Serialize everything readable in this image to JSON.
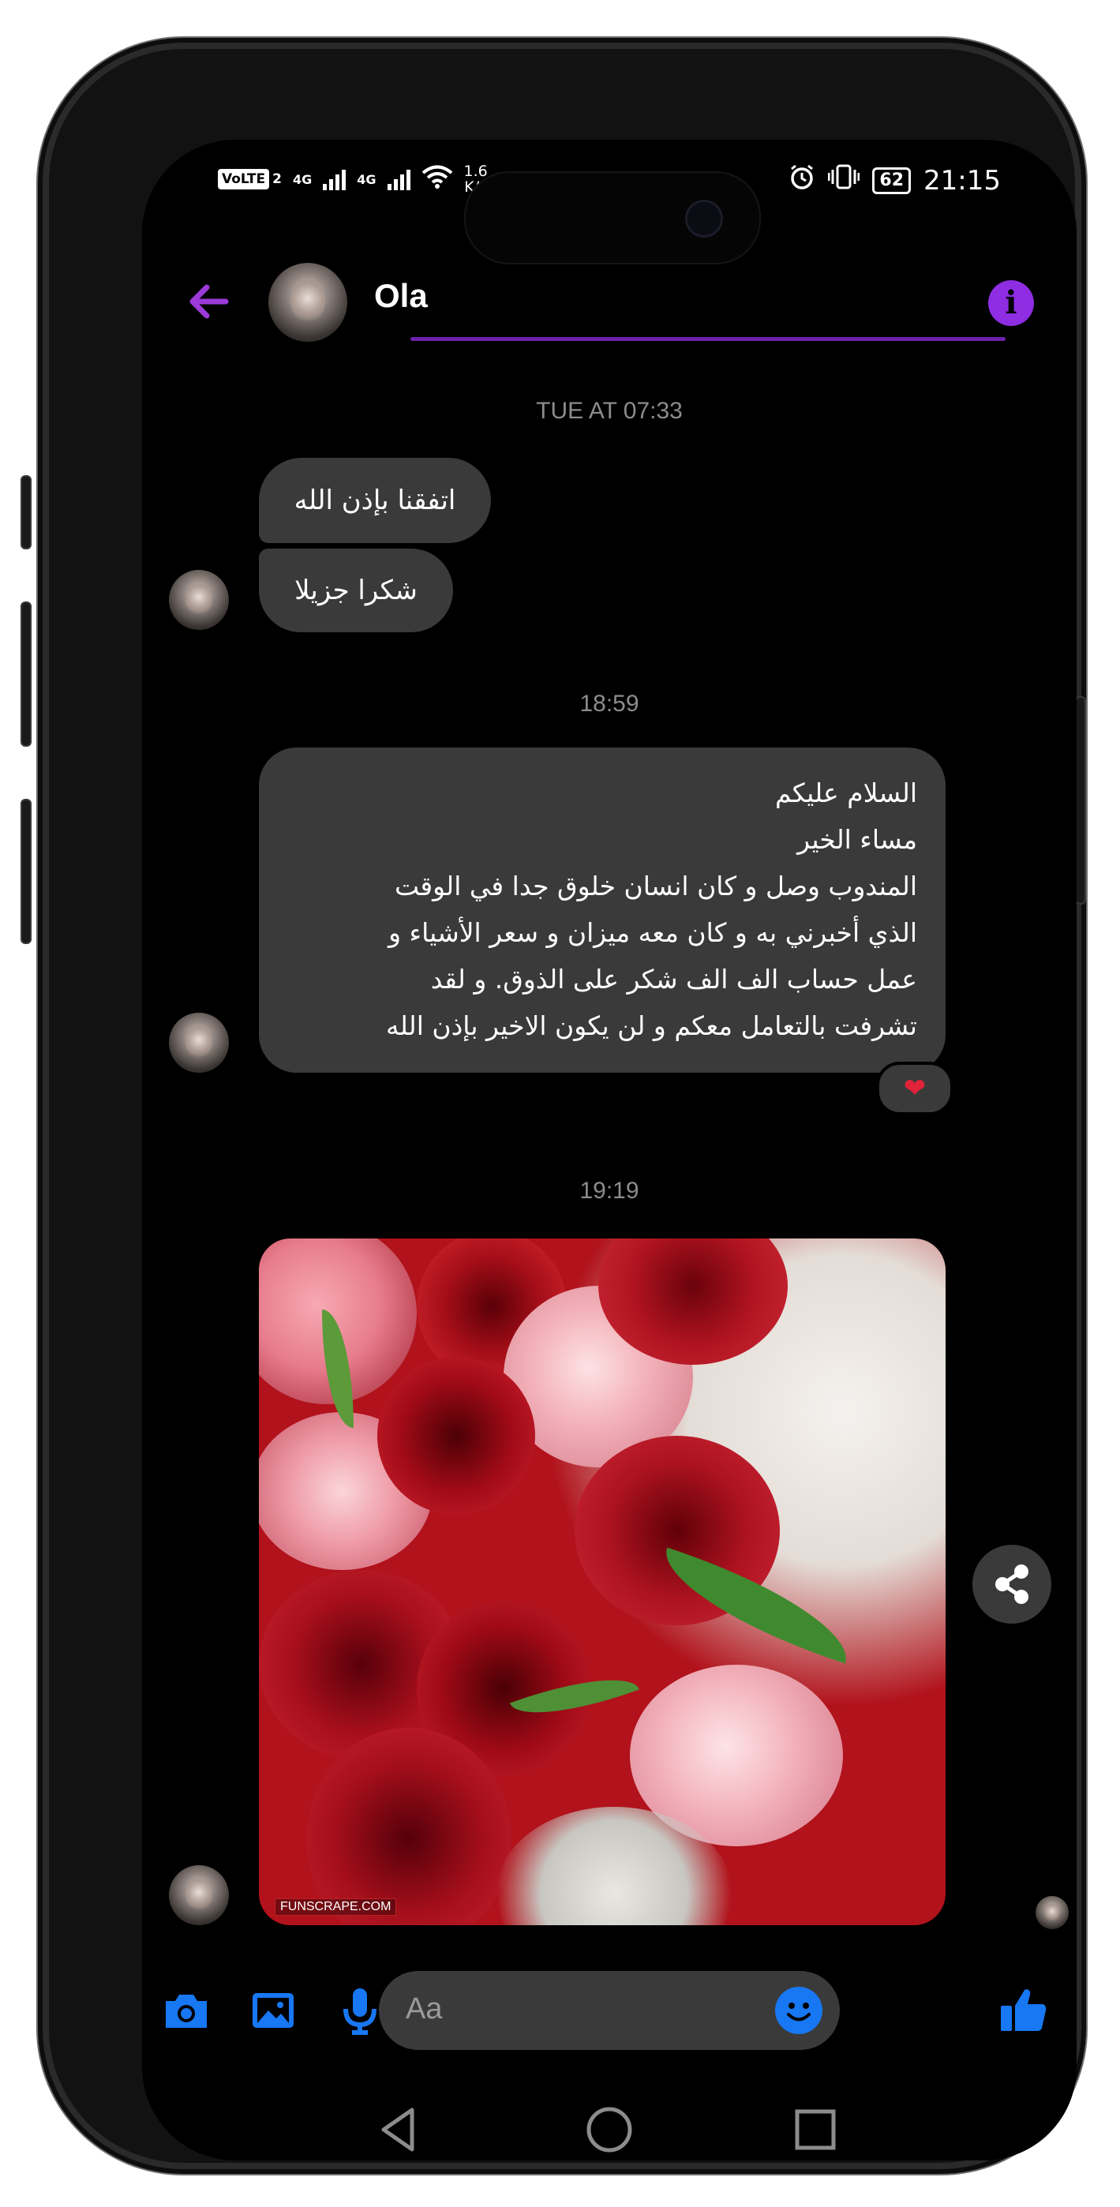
{
  "status_bar": {
    "volte": "VoLTE",
    "sim": "2",
    "net1": "4G",
    "net2": "4G",
    "speed_value": "1.6",
    "speed_unit": "K/s",
    "battery": "62",
    "time": "21:15"
  },
  "header": {
    "contact_name": "Ola",
    "info_glyph": "i"
  },
  "messages": {
    "ts1": "TUE AT 07:33",
    "m1": "اتفقنا بإذن الله",
    "m2": "شكرا جزيلا",
    "ts2": "18:59",
    "m3": "السلام عليكم\nمساء الخير\nالمندوب وصل و كان انسان خلوق جدا  في الوقت\nالذي أخبرني به و كان معه ميزان و  سعر الأشياء و\nعمل  حساب الف الف شكر على الذوق. و لقد\nتشرفت بالتعامل معكم و لن يكون الاخير بإذن الله",
    "reaction": "❤",
    "ts3": "19:19",
    "image_watermark": "FUNSCRAPE.COM"
  },
  "composer": {
    "placeholder": "Aa",
    "icons": [
      "camera-icon",
      "gallery-icon",
      "microphone-icon",
      "chat-bubble-icon",
      "emoji-icon",
      "thumbs-up-icon"
    ]
  },
  "colors": {
    "accent_purple": "#8e2de2",
    "messenger_blue": "#1877f2",
    "bubble": "#3a3a3a",
    "heart": "#e0233a"
  }
}
